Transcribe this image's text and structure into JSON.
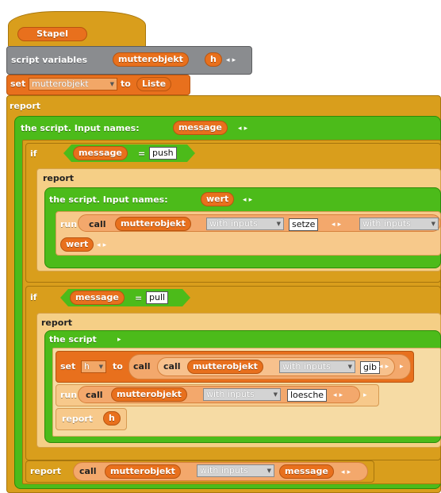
{
  "hat": {
    "label": "Stapel"
  },
  "script_vars": {
    "label": "script variables",
    "vars": [
      "mutterobjekt",
      "h"
    ],
    "arrows": "◂ ▸"
  },
  "set1": {
    "set": "set",
    "var": "mutterobjekt",
    "to": "to",
    "value": "Liste"
  },
  "report1": {
    "label": "report"
  },
  "ring1": {
    "label": "the script. Input names:",
    "param": "message",
    "arrows": "◂ ▸"
  },
  "if1": {
    "label": "if",
    "left": "message",
    "eq": "=",
    "right": "push"
  },
  "report2": {
    "label": "report"
  },
  "ring2": {
    "label": "the script. Input names:",
    "param": "wert",
    "arrows": "◂ ▸"
  },
  "run1": {
    "run": "run",
    "call": "call",
    "obj": "mutterobjekt",
    "with": "with inputs",
    "slot": "setze",
    "arrows": "◂ ▸",
    "with2": "with inputs",
    "param": "wert",
    "arrows2": "◂ ▸"
  },
  "if2": {
    "label": "if",
    "left": "message",
    "eq": "=",
    "right": "pull"
  },
  "report3": {
    "label": "report"
  },
  "ring3": {
    "label": "the script",
    "arrow": "▸"
  },
  "set2": {
    "set": "set",
    "var": "h",
    "to": "to",
    "call": "call",
    "call2": "call",
    "obj": "mutterobjekt",
    "with": "with inputs",
    "slot": "gib",
    "arrows": "◂ ▸",
    "arrow": "▸"
  },
  "run2": {
    "run": "run",
    "call": "call",
    "obj": "mutterobjekt",
    "with": "with inputs",
    "slot": "loesche",
    "arrows": "◂ ▸",
    "arrow": "▸"
  },
  "report4": {
    "label": "report",
    "value": "h"
  },
  "report5": {
    "label": "report",
    "call": "call",
    "obj": "mutterobjekt",
    "with": "with inputs",
    "param": "message",
    "arrows": "◂ ▸"
  }
}
